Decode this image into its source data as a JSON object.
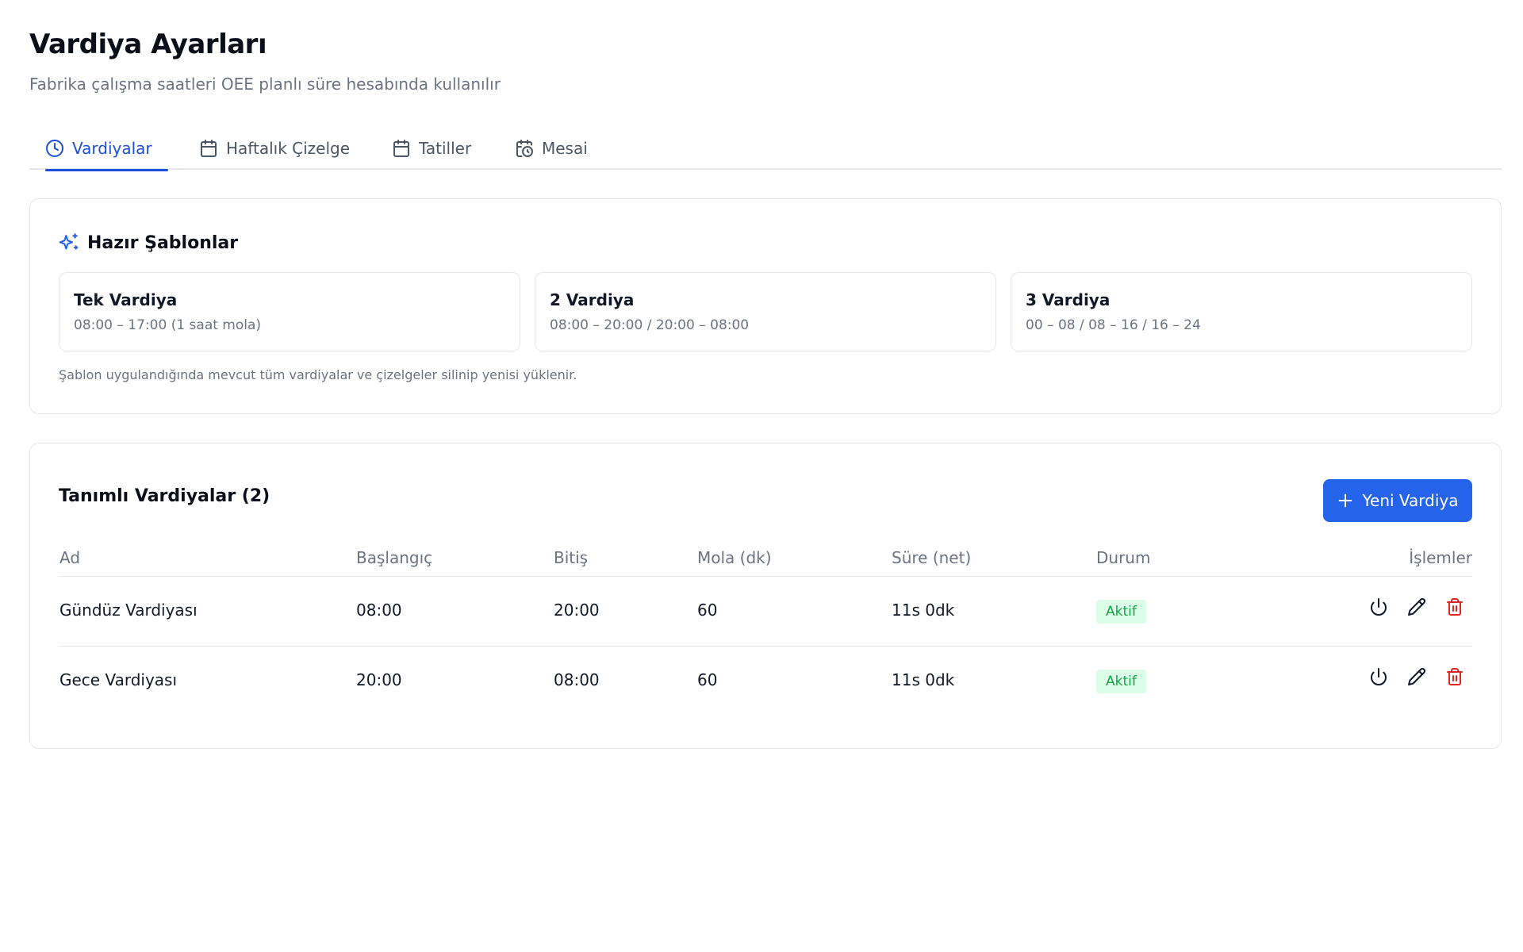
{
  "page": {
    "title": "Vardiya Ayarları",
    "subtitle": "Fabrika çalışma saatleri OEE planlı süre hesabında kullanılır"
  },
  "tabs": [
    {
      "label": "Vardiyalar",
      "icon": "clock-icon",
      "active": true
    },
    {
      "label": "Haftalık Çizelge",
      "icon": "calendar-icon",
      "active": false
    },
    {
      "label": "Tatiller",
      "icon": "calendar-icon",
      "active": false
    },
    {
      "label": "Mesai",
      "icon": "calendar-clock-icon",
      "active": false
    }
  ],
  "templates": {
    "title": "Hazır Şablonlar",
    "icon": "sparkles-icon",
    "items": [
      {
        "name": "Tek Vardiya",
        "time": "08:00 – 17:00 (1 saat mola)"
      },
      {
        "name": "2 Vardiya",
        "time": "08:00 – 20:00 / 20:00 – 08:00"
      },
      {
        "name": "3 Vardiya",
        "time": "00 – 08 / 08 – 16 / 16 – 24"
      }
    ],
    "note": "Şablon uygulandığında mevcut tüm vardiyalar ve çizelgeler silinip yenisi yüklenir."
  },
  "shifts": {
    "title": "Tanımlı Vardiyalar (2)",
    "new_button": "Yeni Vardiya",
    "columns": [
      "Ad",
      "Başlangıç",
      "Bitiş",
      "Mola (dk)",
      "Süre (net)",
      "Durum",
      "İşlemler"
    ],
    "rows": [
      {
        "name": "Gündüz Vardiyası",
        "start": "08:00",
        "end": "20:00",
        "break": "60",
        "duration": "11s 0dk",
        "status": "Aktif"
      },
      {
        "name": "Gece Vardiyası",
        "start": "20:00",
        "end": "08:00",
        "break": "60",
        "duration": "11s 0dk",
        "status": "Aktif"
      }
    ]
  },
  "colors": {
    "accent": "#2563eb",
    "active_tab": "#1d4ed8",
    "status_bg": "#dcfce7",
    "status_text": "#16a34a",
    "delete": "#dc2626"
  }
}
